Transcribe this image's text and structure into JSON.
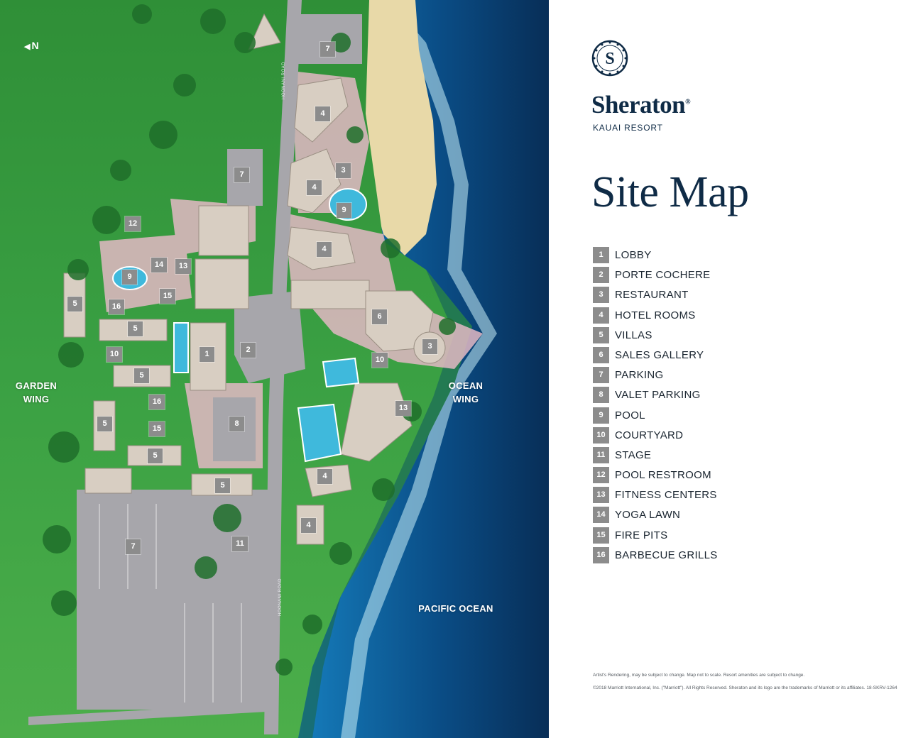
{
  "colors": {
    "brand_navy": "#0f2b46",
    "marker_gray": "#8c8c8c",
    "lawn_green": "#2f9a3c",
    "ocean_blue": "#1a8fd0",
    "deep_ocean": "#0a3a6a",
    "sand": "#e8d9a8",
    "road_gray": "#a7a6ab",
    "path_pink": "#e3b8c4"
  },
  "brand": {
    "emblem": "sheraton-s-emblem",
    "name": "Sheraton",
    "registered": "®",
    "subtitle": "KAUAI RESORT"
  },
  "title": "Site Map",
  "map": {
    "north_label": "N",
    "labels": {
      "garden_wing": "GARDEN WING",
      "ocean_wing": "OCEAN WING",
      "pacific_ocean": "PACIFIC OCEAN"
    },
    "road_names": [
      "HOONANI ROAD",
      "HOONANI ROAD"
    ],
    "markers": [
      "7",
      "4",
      "3",
      "7",
      "4",
      "9",
      "4",
      "12",
      "9",
      "14",
      "13",
      "5",
      "16",
      "15",
      "5",
      "1",
      "2",
      "6",
      "3",
      "10",
      "10",
      "5",
      "16",
      "5",
      "15",
      "13",
      "8",
      "5",
      "4",
      "5",
      "4",
      "7",
      "11"
    ]
  },
  "legend": [
    {
      "num": "1",
      "label": "LOBBY"
    },
    {
      "num": "2",
      "label": "PORTE COCHERE"
    },
    {
      "num": "3",
      "label": "RESTAURANT"
    },
    {
      "num": "4",
      "label": "HOTEL ROOMS"
    },
    {
      "num": "5",
      "label": "VILLAS"
    },
    {
      "num": "6",
      "label": "SALES GALLERY"
    },
    {
      "num": "7",
      "label": "PARKING"
    },
    {
      "num": "8",
      "label": "VALET PARKING"
    },
    {
      "num": "9",
      "label": "POOL"
    },
    {
      "num": "10",
      "label": "COURTYARD"
    },
    {
      "num": "11",
      "label": "STAGE"
    },
    {
      "num": "12",
      "label": "POOL RESTROOM"
    },
    {
      "num": "13",
      "label": "FITNESS CENTERS"
    },
    {
      "num": "14",
      "label": "YOGA LAWN"
    },
    {
      "num": "15",
      "label": "FIRE PITS"
    },
    {
      "num": "16",
      "label": "BARBECUE GRILLS"
    }
  ],
  "footer": {
    "disclaimer": "Artist's Rendering, may be subject to change. Map not to scale. Resort amenities are subject to change.",
    "copyright": "©2018 Marriott International, Inc. (\"Marriott\"). All Rights Reserved. Sheraton and its logo are the trademarks of Marriott or its affiliates. 18-SKRV-1264"
  }
}
